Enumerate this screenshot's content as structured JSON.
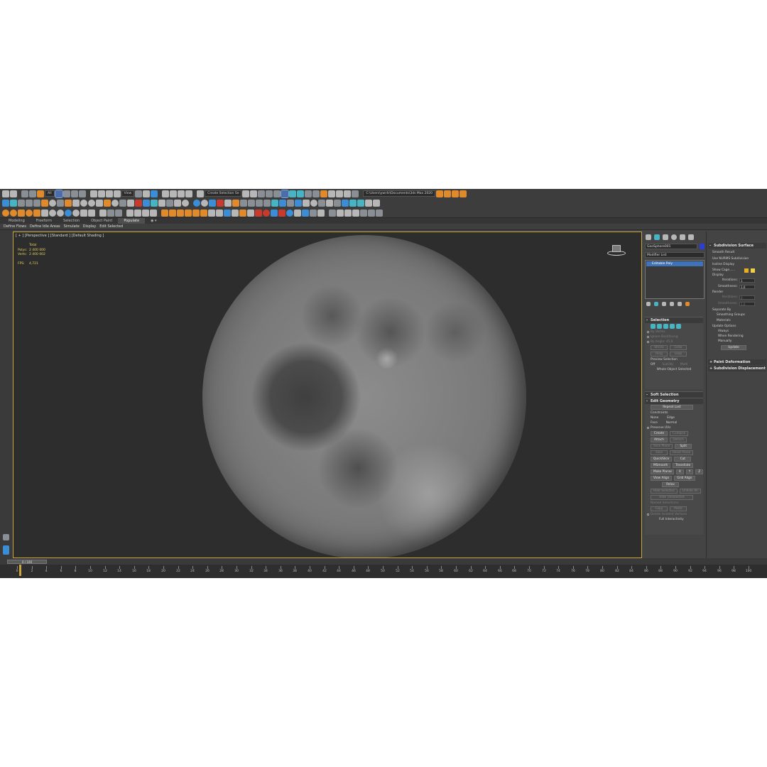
{
  "toolbar": {
    "filter_dropdown": "All",
    "view_dropdown": "View",
    "selection_set_dropdown": "Create Selection Se",
    "project_path": "C:\\Users\\ywr4r\\Documents\\3ds Max 2020"
  },
  "ribbon": {
    "tabs": [
      "Modeling",
      "Freeform",
      "Selection",
      "Object Paint",
      "Populate"
    ],
    "active_tab": "Populate",
    "sub_items": [
      "Define Flows",
      "Define Idle Areas",
      "Simulate",
      "Display",
      "Edit Selected"
    ]
  },
  "viewport": {
    "label": "[ + ] [Perspective ] [Standard ] [Default Shading ]",
    "stats": {
      "total_label": "Total",
      "polys_label": "Polys:",
      "polys_value": "2 400 000",
      "verts_label": "Verts:",
      "verts_value": "2 400 002",
      "fps_label": "FPS:",
      "fps_value": "4,721"
    }
  },
  "command_panel": {
    "object_name": "GeoSphere001",
    "object_color": "#2b3fd6",
    "modifier_list": "Modifier List",
    "stack_item": "Editable Poly",
    "selection": {
      "header": "Selection",
      "by_vertex": "By Vertex",
      "ignore_backfacing": "Ignore Backfacing",
      "by_angle": "By Angle:",
      "by_angle_value": "45,0",
      "shrink": "Shrink",
      "grow": "Grow",
      "ring": "Ring",
      "loop": "Loop",
      "preview_selection": "Preview Selection",
      "preview_options": [
        "Off",
        "SubObj",
        "Multi"
      ],
      "status": "Whole Object Selected"
    },
    "soft_selection": {
      "header": "Soft Selection"
    },
    "edit_geometry": {
      "header": "Edit Geometry",
      "repeat_last": "Repeat Last",
      "constraints_label": "Constraints",
      "constraints": [
        "None",
        "Edge",
        "Face",
        "Normal"
      ],
      "preserve_uvs": "Preserve UVs",
      "buttons_row1": [
        "Create",
        "Collapse"
      ],
      "buttons_row2": [
        "Attach",
        "Detach"
      ],
      "buttons_row3": [
        "Slice Plane",
        "Split"
      ],
      "buttons_row4": [
        "Slice",
        "Reset Plane"
      ],
      "buttons_row5": [
        "QuickSlice",
        "Cut"
      ],
      "buttons_row6": [
        "MSmooth",
        "Tessellate"
      ],
      "make_planar": "Make Planar",
      "xyz": [
        "X",
        "Y",
        "Z"
      ],
      "buttons_row8": [
        "View Align",
        "Grid Align"
      ],
      "relax": "Relax",
      "buttons_row10": [
        "Hide Selected",
        "Unhide All"
      ],
      "hide_unselected": "Hide Unselected",
      "named_selections": "Named Selections:",
      "copy_paste": [
        "Copy",
        "Paste"
      ],
      "delete_isolated": "Delete Isolated Vertices",
      "full_interactivity": "Full Interactivity"
    }
  },
  "subdivision": {
    "header": "Subdivision Surface",
    "smooth_result": "Smooth Result",
    "use_nurms": "Use NURMS Subdivision",
    "isoline_display": "Isoline Display",
    "show_cage": "Show Cage......",
    "cage_colors": [
      "#e8b020",
      "#f0d040"
    ],
    "display_label": "Display",
    "iterations_label": "Iterations:",
    "display_iterations": "1",
    "smoothness_label": "Smoothness:",
    "display_smoothness": "1,0",
    "render_label": "Render",
    "render_iterations": "0",
    "render_smoothness": "1,0",
    "separate_by": "Separate By",
    "smoothing_groups": "Smoothing Groups",
    "materials": "Materials",
    "update_options": "Update Options",
    "update_choices": [
      "Always",
      "When Rendering",
      "Manually"
    ],
    "update_button": "Update",
    "paint_deformation": "Paint Deformation",
    "subdivision_displacement": "Subdivision Displacement"
  },
  "timeline": {
    "slider_label": "0 / 100",
    "tick_labels": [
      "0",
      "2",
      "4",
      "6",
      "8",
      "10",
      "12",
      "14",
      "16",
      "18",
      "20",
      "22",
      "24",
      "26",
      "28",
      "30",
      "32",
      "34",
      "36",
      "38",
      "40",
      "42",
      "44",
      "46",
      "48",
      "50",
      "52",
      "54",
      "56",
      "58",
      "60",
      "62",
      "64",
      "66",
      "68",
      "70",
      "72",
      "74",
      "76",
      "78",
      "80",
      "82",
      "84",
      "86",
      "88",
      "90",
      "92",
      "94",
      "96",
      "98",
      "100"
    ]
  }
}
